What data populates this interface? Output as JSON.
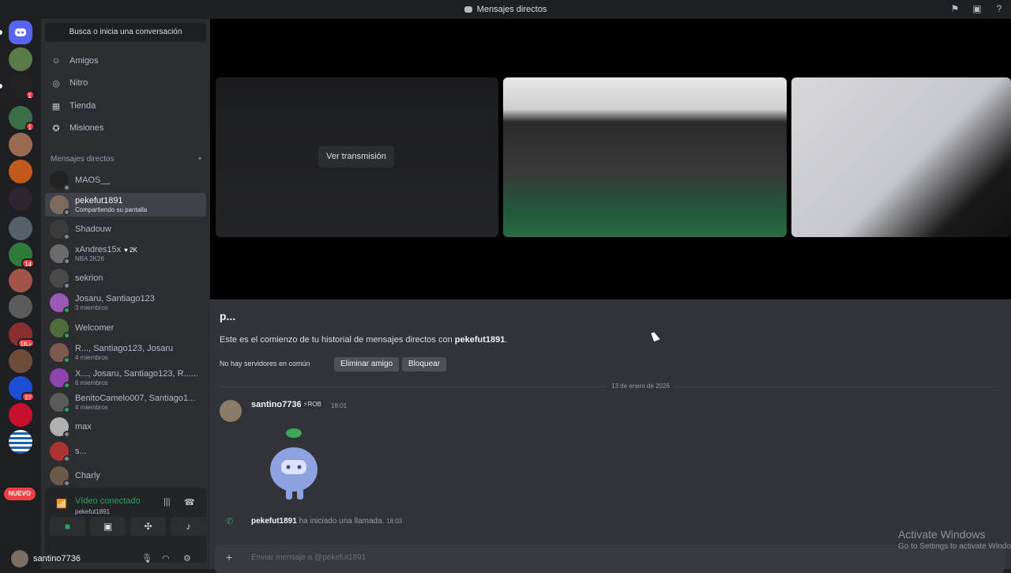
{
  "titlebar": {
    "title": "Mensajes directos",
    "icons": [
      "inbox-flag-icon",
      "download-icon",
      "help-icon"
    ]
  },
  "rail": {
    "nuevo_label": "NUEVO",
    "badges": [
      "1",
      "1",
      "14",
      "1K+",
      "37"
    ]
  },
  "sidebar": {
    "search_label": "Busca o inicia una conversación",
    "nav": [
      {
        "label": "Amigos",
        "icon": "friends-icon"
      },
      {
        "label": "Nitro",
        "icon": "nitro-icon"
      },
      {
        "label": "Tienda",
        "icon": "shop-icon"
      },
      {
        "label": "Misiones",
        "icon": "quests-icon"
      }
    ],
    "dm_header": "Mensajes directos",
    "dms": [
      {
        "name": "MAOS__",
        "sub": ""
      },
      {
        "name": "pekefut1891",
        "sub": "Compartiendo su pantalla"
      },
      {
        "name": "Shadouw",
        "sub": ""
      },
      {
        "name": "xAndres15x",
        "tag": "2K",
        "sub": "NBA 2K26"
      },
      {
        "name": "sekrion",
        "sub": ""
      },
      {
        "name": "Josaru, Santiago123",
        "sub": "3 miembros"
      },
      {
        "name": "Welcomer",
        "sub": ""
      },
      {
        "name": "R..., Santiago123, Josaru",
        "sub": "4 miembros"
      },
      {
        "name": "X..., Josaru, Santiago123, R......",
        "sub": "6 miembros"
      },
      {
        "name": "BenitoCamelo007, Santiago1...",
        "sub": "4 miembros"
      },
      {
        "name": "max",
        "sub": ""
      },
      {
        "name": "s...",
        "sub": ""
      },
      {
        "name": "Charly",
        "sub": ""
      }
    ]
  },
  "voice": {
    "title": "Vídeo conectado",
    "channel": "pekefut1891"
  },
  "user": {
    "name": "santino7736"
  },
  "stage": {
    "watch_label": "Ver transmisión"
  },
  "chat": {
    "title": "p...",
    "intro_prefix": "Este es el comienzo de tu historial de mensajes directos con ",
    "intro_user": "pekefut1891",
    "intro_suffix": ".",
    "no_servers": "No hay servidores en común",
    "remove_friend": "Eliminar amigo",
    "block": "Bloquear",
    "date": "13 de enero de 2026",
    "message": {
      "user": "santino7736",
      "tag": "ROB",
      "time": "18:01"
    },
    "call": {
      "user": "pekefut1891",
      "text": " ha iniciado una llamada.",
      "time": "18:03"
    },
    "composer_placeholder": "Enviar mensaje a @pekefut1891"
  },
  "watermark": {
    "line1": "Activate Windows",
    "line2": "Go to Settings to activate Windows."
  }
}
